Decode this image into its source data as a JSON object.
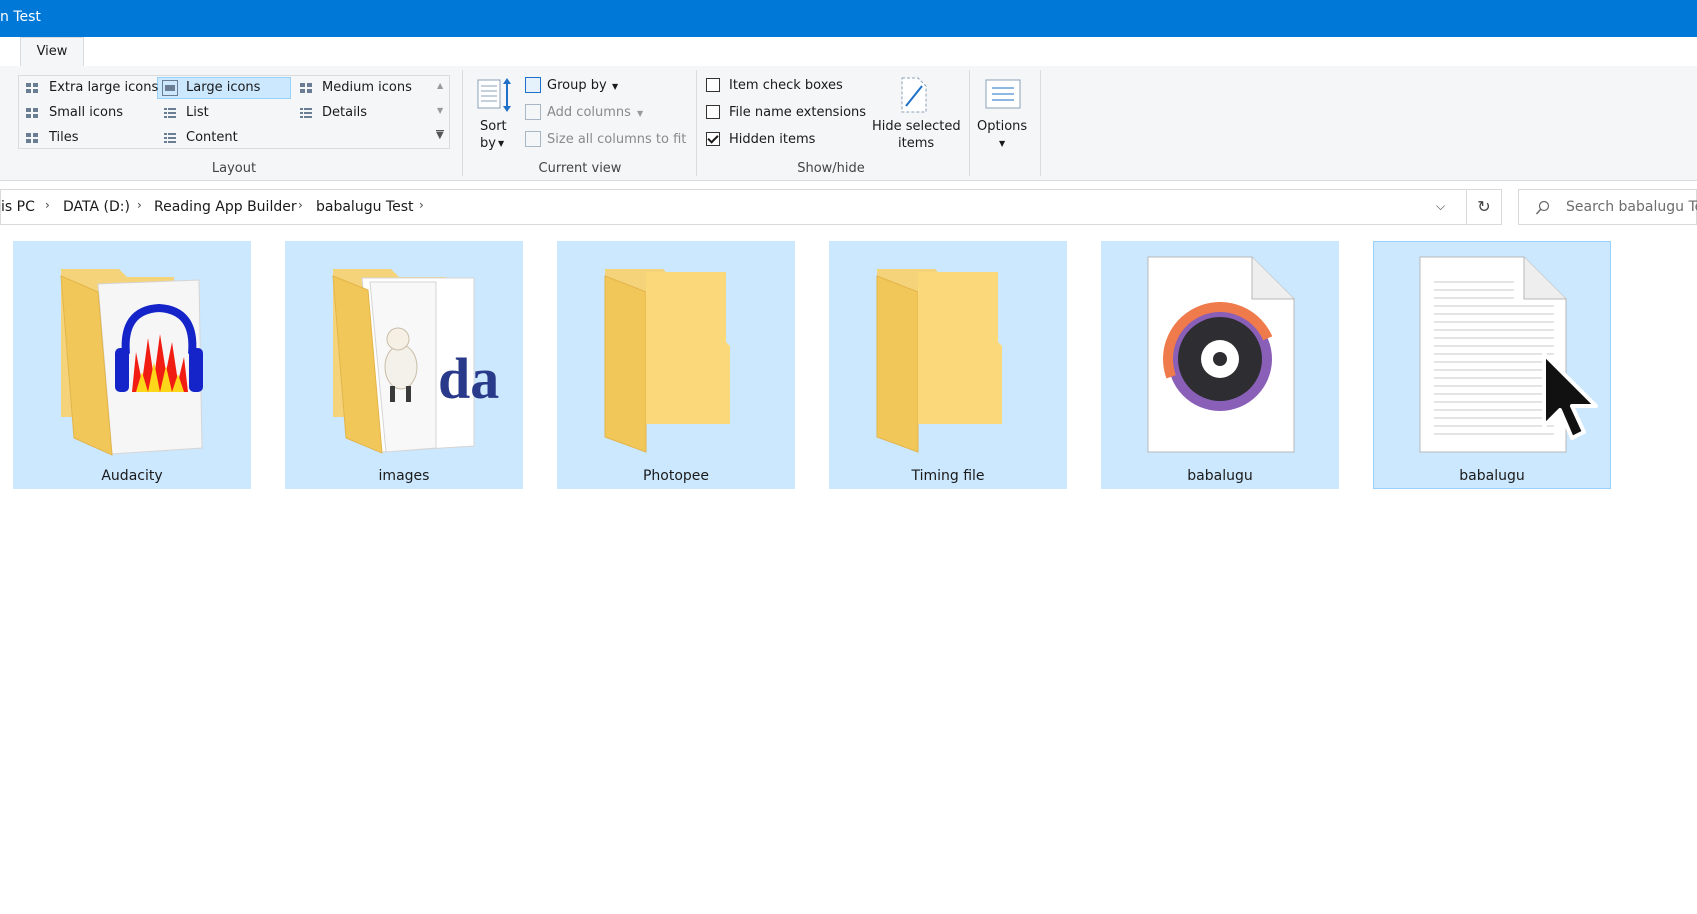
{
  "window": {
    "title": "n Test"
  },
  "ribbon": {
    "tab": "View",
    "layout": {
      "group_label": "Layout",
      "options": {
        "extra_large": "Extra large icons",
        "large": "Large icons",
        "medium": "Medium icons",
        "small": "Small icons",
        "list": "List",
        "details": "Details",
        "tiles": "Tiles",
        "content": "Content"
      },
      "selected": "Large icons"
    },
    "current_view": {
      "group_label": "Current view",
      "sort_by": "Sort",
      "sort_by_2": "by",
      "group_by": "Group by",
      "add_columns": "Add columns",
      "size_columns": "Size all columns to fit"
    },
    "show_hide": {
      "group_label": "Show/hide",
      "item_check_boxes": {
        "label": "Item check boxes",
        "checked": false
      },
      "file_name_extensions": {
        "label": "File name extensions",
        "checked": false
      },
      "hidden_items": {
        "label": "Hidden items",
        "checked": true
      },
      "hide_selected": "Hide selected",
      "hide_selected_2": "items"
    },
    "options": {
      "label": "Options"
    }
  },
  "address": {
    "crumbs": [
      "is PC",
      "DATA (D:)",
      "Reading App Builder",
      "babalugu Test"
    ]
  },
  "search": {
    "placeholder": "Search babalugu Tes"
  },
  "files": [
    {
      "name": "Audacity",
      "icon": "folder-audacity-icon"
    },
    {
      "name": "images",
      "icon": "folder-images-icon"
    },
    {
      "name": "Photopee",
      "icon": "folder-icon"
    },
    {
      "name": "Timing file",
      "icon": "folder-icon"
    },
    {
      "name": "babalugu",
      "icon": "audio-file-icon"
    },
    {
      "name": "babalugu",
      "icon": "text-file-icon"
    }
  ],
  "colors": {
    "accent": "#0078d7",
    "selection": "#cce8ff",
    "selection_border": "#99d1ff"
  }
}
